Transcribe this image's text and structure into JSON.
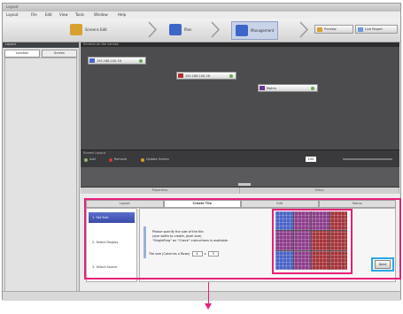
{
  "window": {
    "title": "Layout"
  },
  "menu": [
    "Layout",
    "File",
    "Edit",
    "View",
    "Tools",
    "Window",
    "Help"
  ],
  "wizard": {
    "steps": [
      {
        "label": "Screens Edit",
        "icon": "screens-edit-icon",
        "color": "#d8a030"
      },
      {
        "label": "Plan",
        "icon": "plan-icon",
        "color": "#3e66c8"
      },
      {
        "label": "Management",
        "icon": "management-icon",
        "color": "#3e66c8"
      }
    ],
    "buttons": [
      {
        "label": "Preview",
        "icon": "preview-icon"
      },
      {
        "label": "Live Report",
        "icon": "live-report-icon"
      }
    ]
  },
  "left_panel": {
    "title": "Layout",
    "tabs": [
      "Location",
      "Screen"
    ]
  },
  "canvas": {
    "title": "Screens on the canvas",
    "nodes": [
      {
        "label": "192.168.100.16",
        "icon": "display-icon"
      },
      {
        "label": "192.168.100.16",
        "icon": "display-icon"
      },
      {
        "label": "Matrix",
        "icon": "matrix-icon"
      }
    ],
    "footer": {
      "label": "Screen Layout",
      "items": [
        "Add",
        "Remove",
        "Update Screen"
      ],
      "zoom": "100"
    }
  },
  "bottom_tabs": [
    "Properties",
    "Setup"
  ],
  "steps_tabs": [
    {
      "label": "Layout",
      "active": false
    },
    {
      "label": "Create Tile",
      "active": true
    },
    {
      "label": "Edit",
      "active": false
    },
    {
      "label": "Status",
      "active": false
    }
  ],
  "steps_sidebar": [
    "1. Set Size",
    "2. Select Display",
    "3. Select Source"
  ],
  "instruction": {
    "line1": "Please specify the size of the tile.",
    "line2": "(size width to create, pixel size)",
    "line3": "\"SingleRing\" on \"Check\" instructions is available."
  },
  "size": {
    "label": "Tile size (Columns x Rows)",
    "cols": "4",
    "rows": "3",
    "sep": "x"
  },
  "next_label": "Next",
  "highlight_colors": {
    "pink": "#e8207a",
    "blue": "#2ea6e6"
  },
  "grid": {
    "cols": 4,
    "rows": 3,
    "cells": [
      "blue",
      "purple",
      "purple",
      "red",
      "purple",
      "purple",
      "red",
      "red",
      "blue",
      "purple",
      "red",
      "red"
    ]
  },
  "cell_colors": {
    "blue": "#4a63c6",
    "purple": "#8c3d8a",
    "red": "#a4343a"
  }
}
